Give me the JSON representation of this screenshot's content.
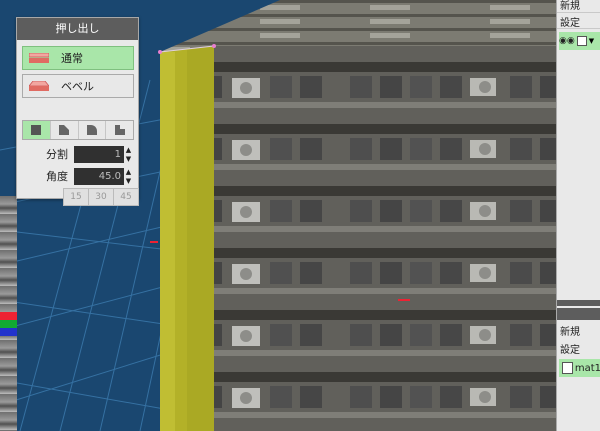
{
  "extrude_panel": {
    "title": "押し出し",
    "modes": [
      {
        "label": "通常",
        "icon": "flat-extrude-icon",
        "active": true
      },
      {
        "label": "ベベル",
        "icon": "bevel-extrude-icon",
        "active": false
      }
    ],
    "shapes": [
      {
        "icon": "square-shape-icon",
        "active": true
      },
      {
        "icon": "bevel-corner-icon",
        "active": false
      },
      {
        "icon": "round-corner-icon",
        "active": false
      },
      {
        "icon": "step-corner-icon",
        "active": false
      }
    ],
    "divisions": {
      "label": "分割",
      "value": "1"
    },
    "angle": {
      "label": "角度",
      "value": "45.0"
    },
    "angle_presets": [
      "15",
      "30",
      "45"
    ]
  },
  "right_panel": {
    "top_label": "新規",
    "settings_label": "設定",
    "lower_new_label": "新規",
    "lower_settings_label": "設定",
    "material_item": "mat1"
  },
  "colors": {
    "viewport_bg": "#1a4770",
    "active_green": "#a9e6a9",
    "panel_bg": "#e9e9e9",
    "title_bar": "#5d5d5d",
    "extrude_face": "#b3b128"
  }
}
